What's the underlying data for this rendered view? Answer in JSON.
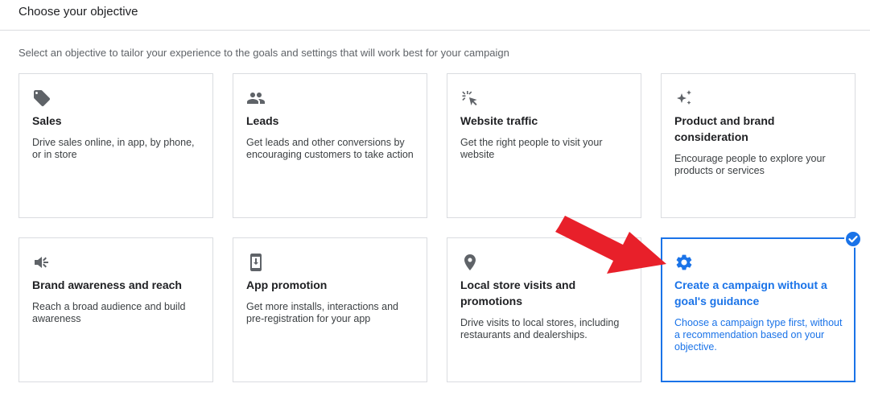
{
  "header": {
    "title": "Choose your objective"
  },
  "subtitle": "Select an objective to tailor your experience to the goals and settings that will work best for your campaign",
  "colors": {
    "accent": "#1a73e8",
    "arrow": "#e8202a",
    "icon": "#5f6368"
  },
  "objectives": [
    {
      "title": "Sales",
      "description": "Drive sales online, in app, by phone, or in store",
      "icon": "tag-icon"
    },
    {
      "title": "Leads",
      "description": "Get leads and other conversions by encouraging customers to take action",
      "icon": "people-icon"
    },
    {
      "title": "Website traffic",
      "description": "Get the right people to visit your website",
      "icon": "cursor-click-icon"
    },
    {
      "title": "Product and brand consideration",
      "description": "Encourage people to explore your products or services",
      "icon": "sparkle-icon"
    },
    {
      "title": "Brand awareness and reach",
      "description": "Reach a broad audience and build awareness",
      "icon": "speaker-icon"
    },
    {
      "title": "App promotion",
      "description": "Get more installs, interactions and pre-registration for your app",
      "icon": "phone-download-icon"
    },
    {
      "title": "Local store visits and promotions",
      "description": "Drive visits to local stores, including restaurants and dealerships.",
      "icon": "location-pin-icon"
    },
    {
      "title": "Create a campaign without a goal's guidance",
      "description": "Choose a campaign type first, without a recommendation based on your objective.",
      "icon": "gear-icon",
      "selected": true
    }
  ]
}
